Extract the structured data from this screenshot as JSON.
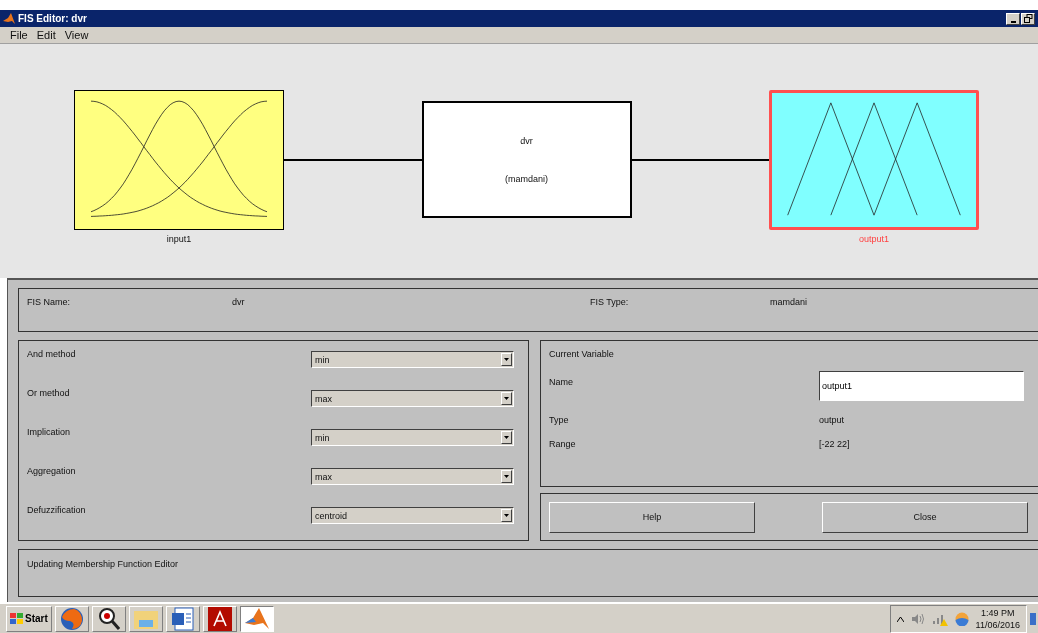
{
  "window": {
    "title": "FIS Editor: dvr"
  },
  "menu": [
    {
      "label": "File"
    },
    {
      "label": "Edit"
    },
    {
      "label": "View"
    }
  ],
  "diagram": {
    "nodes": [
      {
        "kind": "input",
        "label": "input1",
        "selected": false
      },
      {
        "kind": "system",
        "name": "dvr",
        "type": "(mamdani)"
      },
      {
        "kind": "output",
        "label": "output1",
        "selected": true
      }
    ]
  },
  "fis": {
    "name_label": "FIS Name:",
    "name": "dvr",
    "type_label": "FIS Type:",
    "type": "mamdani"
  },
  "methods": [
    {
      "label": "And method",
      "value": "min"
    },
    {
      "label": "Or method",
      "value": "max"
    },
    {
      "label": "Implication",
      "value": "min"
    },
    {
      "label": "Aggregation",
      "value": "max"
    },
    {
      "label": "Defuzzification",
      "value": "centroid"
    }
  ],
  "current_variable": {
    "title": "Current Variable",
    "name_label": "Name",
    "name": "output1",
    "type_label": "Type",
    "type": "output",
    "range_label": "Range",
    "range": "[-22 22]"
  },
  "buttons": [
    "Help",
    "Close"
  ],
  "status": "Updating Membership Function Editor",
  "taskbar": {
    "start": "Start",
    "apps": [
      {
        "kind": "browser",
        "selected": false
      },
      {
        "kind": "magnifier",
        "selected": false
      },
      {
        "kind": "folder",
        "selected": false
      },
      {
        "kind": "document",
        "selected": false
      },
      {
        "kind": "pdf",
        "selected": false
      },
      {
        "kind": "matlab",
        "selected": true
      }
    ],
    "time": "1:49 PM",
    "date": "11/06/2016"
  }
}
